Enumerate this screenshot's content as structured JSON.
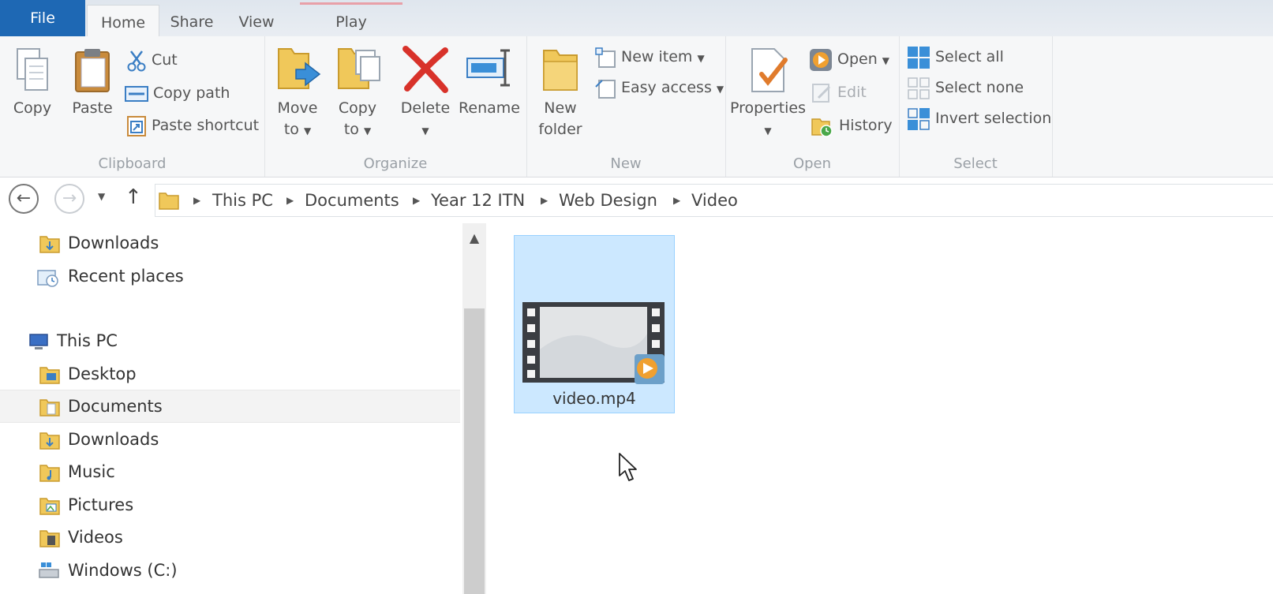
{
  "tabs": {
    "file": "File",
    "home": "Home",
    "share": "Share",
    "view": "View",
    "play": "Play"
  },
  "ribbon": {
    "clipboard": {
      "label": "Clipboard",
      "copy": "Copy",
      "paste": "Paste",
      "cut": "Cut",
      "copy_path": "Copy path",
      "paste_shortcut": "Paste shortcut"
    },
    "organize": {
      "label": "Organize",
      "move_to_line1": "Move",
      "move_to_line2": "to",
      "copy_to_line1": "Copy",
      "copy_to_line2": "to",
      "delete": "Delete",
      "rename": "Rename"
    },
    "new": {
      "label": "New",
      "new_folder_line1": "New",
      "new_folder_line2": "folder",
      "new_item": "New item",
      "easy_access": "Easy access"
    },
    "open": {
      "label": "Open",
      "properties": "Properties",
      "open": "Open",
      "edit": "Edit",
      "history": "History"
    },
    "select": {
      "label": "Select",
      "select_all": "Select all",
      "select_none": "Select none",
      "invert_selection": "Invert selection"
    }
  },
  "address": {
    "crumbs": [
      "This PC",
      "Documents",
      "Year 12 ITN",
      "Web Design",
      "Video"
    ]
  },
  "nav": {
    "items": [
      "Downloads",
      "Recent places",
      "This PC",
      "Desktop",
      "Documents",
      "Downloads",
      "Music",
      "Pictures",
      "Videos",
      "Windows (C:)"
    ]
  },
  "content": {
    "files": [
      {
        "name": "video.mp4",
        "selected": true
      }
    ]
  },
  "colors": {
    "file_tab": "#1e68b4",
    "selection_fill": "#cce8ff",
    "selection_border": "#99d1ff"
  }
}
